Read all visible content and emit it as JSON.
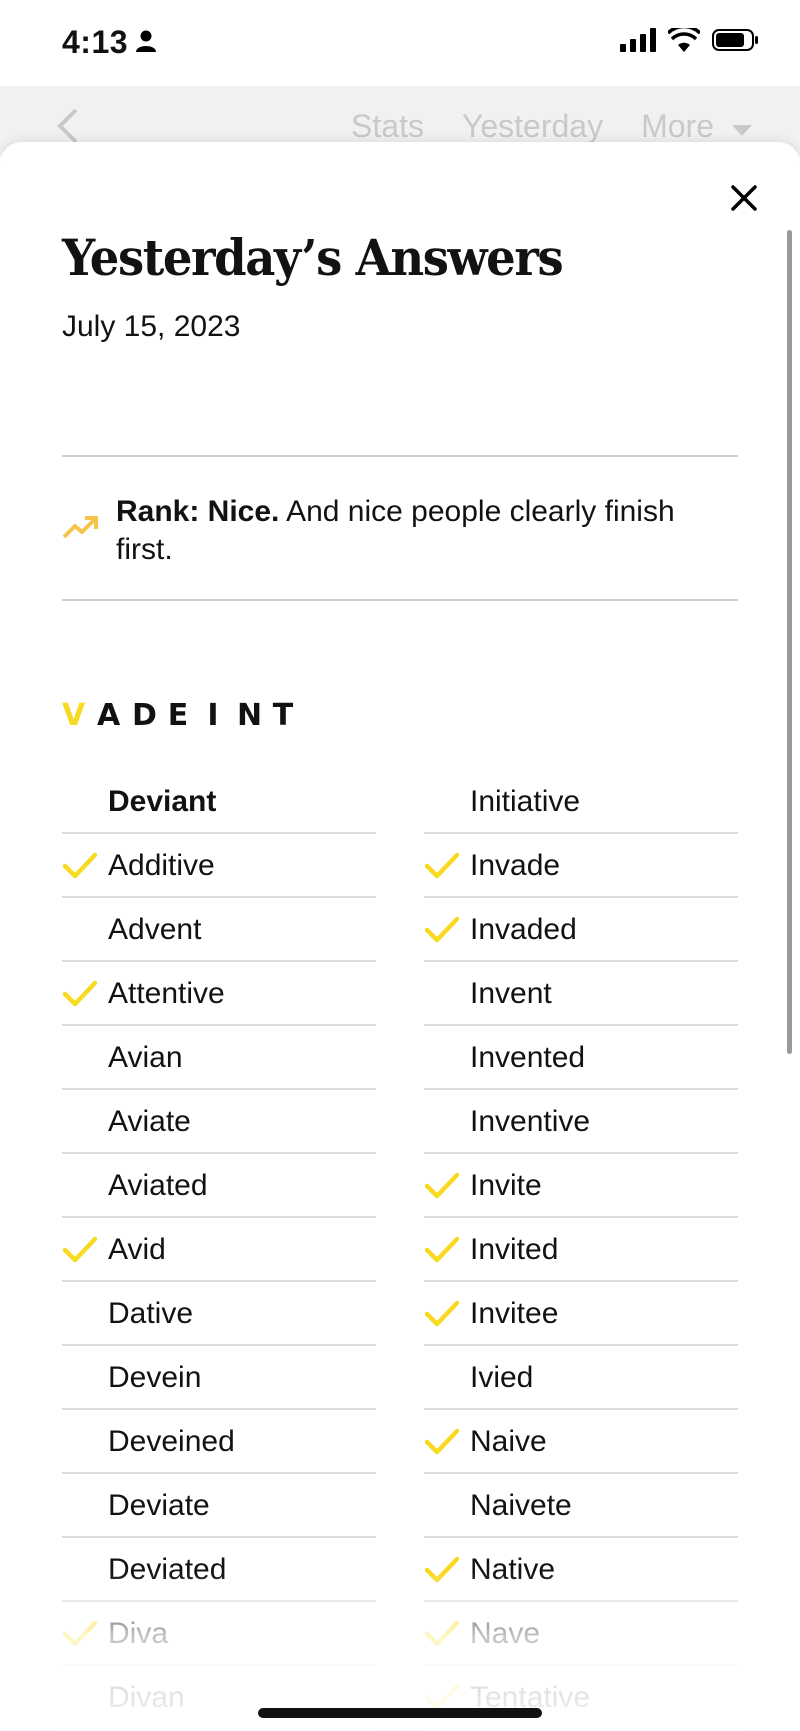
{
  "status_bar": {
    "time": "4:13",
    "icons": [
      "person-icon",
      "cellular-signal-icon",
      "wifi-icon",
      "battery-icon"
    ]
  },
  "nav": {
    "back_icon": "chevron-left-icon",
    "links": [
      "Stats",
      "Yesterday",
      "More"
    ],
    "more_icon": "caret-down-icon"
  },
  "sheet": {
    "close_icon": "close-icon",
    "title": "Yesterday’s Answers",
    "date": "July 15, 2023",
    "rank": {
      "icon": "trending-up-icon",
      "label": "Rank: Nice.",
      "message": "And nice people clearly finish first."
    },
    "letters": {
      "center": "V",
      "outer": [
        "A",
        "D",
        "E",
        "I",
        "N",
        "T"
      ]
    },
    "words_left": [
      {
        "word": "Deviant",
        "found": false,
        "pangram": true
      },
      {
        "word": "Additive",
        "found": true
      },
      {
        "word": "Advent",
        "found": false
      },
      {
        "word": "Attentive",
        "found": true
      },
      {
        "word": "Avian",
        "found": false
      },
      {
        "word": "Aviate",
        "found": false
      },
      {
        "word": "Aviated",
        "found": false
      },
      {
        "word": "Avid",
        "found": true
      },
      {
        "word": "Dative",
        "found": false
      },
      {
        "word": "Devein",
        "found": false
      },
      {
        "word": "Deveined",
        "found": false
      },
      {
        "word": "Deviate",
        "found": false
      },
      {
        "word": "Deviated",
        "found": false
      },
      {
        "word": "Diva",
        "found": true
      },
      {
        "word": "Divan",
        "found": false
      }
    ],
    "words_right": [
      {
        "word": "Initiative",
        "found": false
      },
      {
        "word": "Invade",
        "found": true
      },
      {
        "word": "Invaded",
        "found": true
      },
      {
        "word": "Invent",
        "found": false
      },
      {
        "word": "Invented",
        "found": false
      },
      {
        "word": "Inventive",
        "found": false
      },
      {
        "word": "Invite",
        "found": true
      },
      {
        "word": "Invited",
        "found": true
      },
      {
        "word": "Invitee",
        "found": true
      },
      {
        "word": "Ivied",
        "found": false
      },
      {
        "word": "Naive",
        "found": true
      },
      {
        "word": "Naivete",
        "found": false
      },
      {
        "word": "Native",
        "found": true
      },
      {
        "word": "Nave",
        "found": true
      },
      {
        "word": "Tentative",
        "found": true
      }
    ]
  },
  "colors": {
    "accent": "#f7da21",
    "rank_icon": "#f5c44a",
    "text": "#121212",
    "muted_nav": "#c9c9c9",
    "divider": "#dcdcdc"
  }
}
